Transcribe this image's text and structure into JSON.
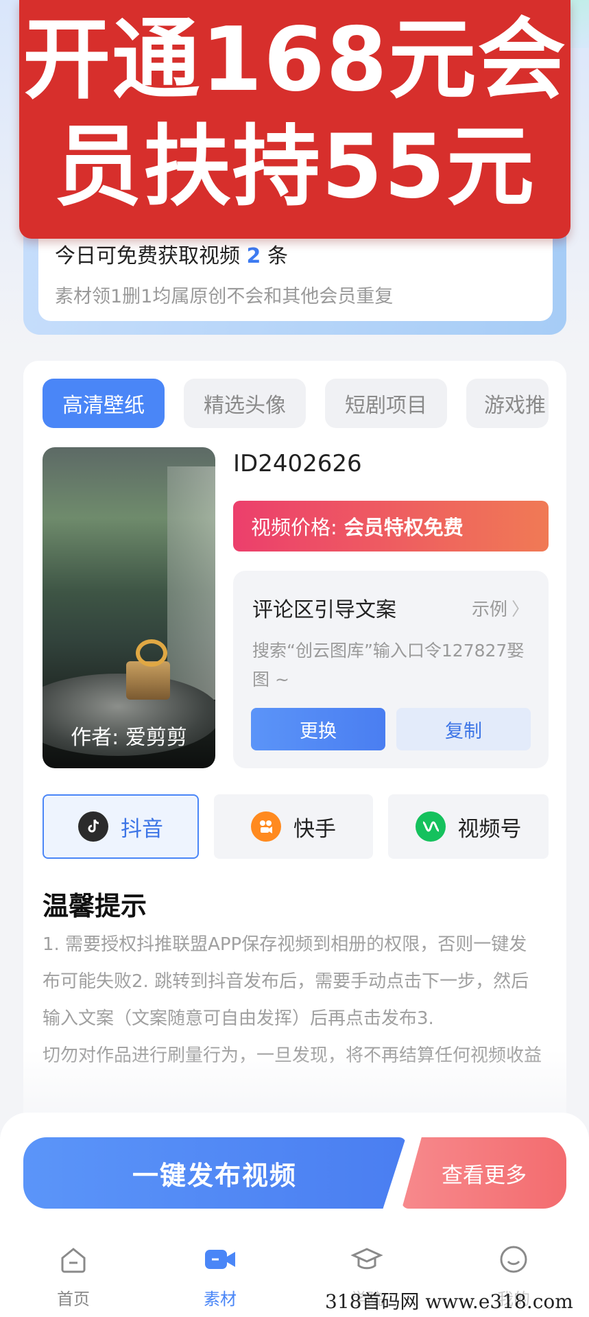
{
  "promo": {
    "line1": "开通168元会",
    "line2": "员扶持55元"
  },
  "free_card": {
    "title_prefix": "今日可免费获取视频",
    "count": "2",
    "title_suffix": "条",
    "subtitle": "素材领1删1均属原创不会和其他会员重复"
  },
  "tabs": [
    {
      "label": "高清壁纸",
      "active": true
    },
    {
      "label": "精选头像",
      "active": false
    },
    {
      "label": "短剧项目",
      "active": false
    },
    {
      "label": "游戏推",
      "active": false
    }
  ],
  "video": {
    "author": "作者: 爱剪剪",
    "id": "ID2402626",
    "price_label": "视频价格:",
    "price_value": "会员特权免费"
  },
  "comment": {
    "title": "评论区引导文案",
    "example": "示例",
    "text": "搜索“创云图库”输入口令127827娶图 ~",
    "change_label": "更换",
    "copy_label": "复制"
  },
  "platforms": [
    {
      "label": "抖音",
      "icon": "douyin-icon",
      "active": true,
      "color": "#2b2b2b"
    },
    {
      "label": "快手",
      "icon": "kuaishou-icon",
      "active": false,
      "color": "#ff8a1f"
    },
    {
      "label": "视频号",
      "icon": "channels-icon",
      "active": false,
      "color": "#15c15d"
    }
  ],
  "tips": {
    "title": "温馨提示",
    "body1": "1. 需要授权抖推联盟APP保存视频到相册的权限，否则一键发布可能失败2. 跳转到抖音发布后，需要手动点击下一步，然后输入文案（文案随意可自由发挥）后再点击发布3.",
    "body2": "切勿对作品进行刷量行为，一旦发现，将不再结算任何视频收益"
  },
  "actions": {
    "publish": "一键发布视频",
    "more": "查看更多"
  },
  "nav": [
    {
      "label": "首页",
      "icon": "home-icon",
      "active": false
    },
    {
      "label": "素材",
      "icon": "video-camera-icon",
      "active": true
    },
    {
      "label": "学院",
      "icon": "graduation-cap-icon",
      "active": false
    },
    {
      "label": "我的",
      "icon": "smile-face-icon",
      "active": false
    }
  ],
  "watermark": "318首码网 www.e318.com",
  "colors": {
    "accent": "#4a86f7",
    "promo_red": "#d72f2c",
    "price_start": "#ec3f6c",
    "price_end": "#f07a55"
  }
}
